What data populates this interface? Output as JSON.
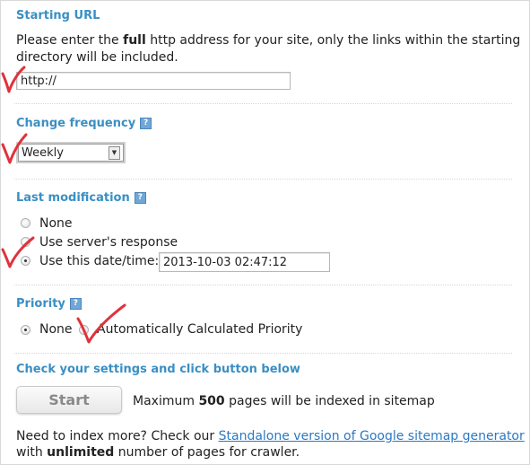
{
  "starting_url": {
    "heading": "Starting URL",
    "desc_part1": "Please enter the ",
    "desc_bold": "full",
    "desc_part2": " http address for your site, only the links within the starting",
    "desc_line2": "directory will be included.",
    "url_value": "http://"
  },
  "change_frequency": {
    "heading": "Change frequency",
    "help_icon": "?",
    "selected": "Weekly"
  },
  "last_modification": {
    "heading": "Last modification",
    "help_icon": "?",
    "options": [
      "None",
      "Use server's response",
      "Use this date/time:"
    ],
    "selected_index": 2,
    "datetime_value": "2013-10-03 02:47:12"
  },
  "priority": {
    "heading": "Priority",
    "help_icon": "?",
    "options": [
      "None",
      "Automatically Calculated Priority"
    ],
    "selected_index": 0
  },
  "submit": {
    "heading": "Check your settings and click button below",
    "start_label": "Start",
    "max_pre": "Maximum ",
    "max_count": "500",
    "max_post": " pages will be indexed in sitemap"
  },
  "footer": {
    "line1_pre": "Need to index more? Check our ",
    "link_text": "Standalone version of Google sitemap generator",
    "line2_pre": "with ",
    "line2_bold": "unlimited",
    "line2_post": " number of pages for crawler."
  },
  "colors": {
    "heading": "#3a8fc4",
    "link": "#2b79c2",
    "check_mark": "#e0323c"
  }
}
